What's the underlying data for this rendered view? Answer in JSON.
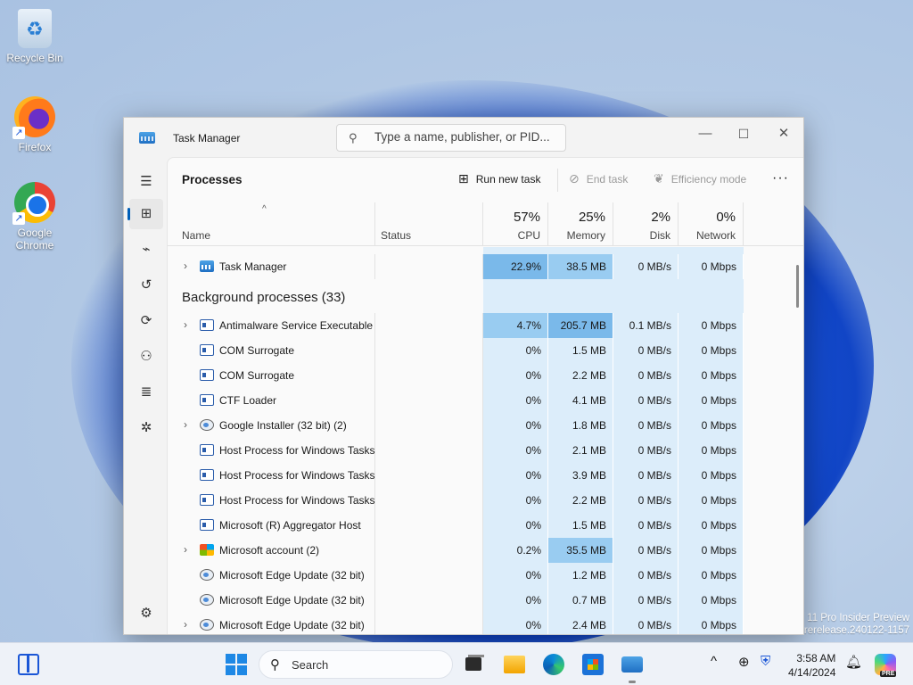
{
  "desktop": {
    "icons": [
      {
        "label": "Recycle Bin"
      },
      {
        "label": "Firefox"
      },
      {
        "label": "Google Chrome"
      }
    ],
    "watermark_line1": "11 Pro Insider Preview",
    "watermark_line2": "rerelease.240122-1157"
  },
  "window": {
    "title": "Task Manager",
    "search_placeholder": "Type a name, publisher, or PID...",
    "controls": {
      "minimize": "—",
      "maximize": "☐",
      "close": "✕"
    }
  },
  "toolbar": {
    "page_title": "Processes",
    "run_new_task": "Run new task",
    "end_task": "End task",
    "efficiency_mode": "Efficiency mode",
    "more": "···"
  },
  "columns": {
    "name": "Name",
    "status": "Status",
    "cpu": {
      "pct": "57%",
      "label": "CPU"
    },
    "memory": {
      "pct": "25%",
      "label": "Memory"
    },
    "disk": {
      "pct": "2%",
      "label": "Disk"
    },
    "network": {
      "pct": "0%",
      "label": "Network"
    }
  },
  "apps": [
    {
      "name": "Task Manager",
      "expand": true,
      "icon": "task-manager-icon",
      "cpu": "22.9%",
      "mem": "38.5 MB",
      "disk": "0 MB/s",
      "net": "0 Mbps"
    }
  ],
  "background_section": "Background processes (33)",
  "processes": [
    {
      "name": "Antimalware Service Executable",
      "expand": true,
      "icon": "service-icon",
      "cpu": "4.7%",
      "mem": "205.7 MB",
      "disk": "0.1 MB/s",
      "net": "0 Mbps"
    },
    {
      "name": "COM Surrogate",
      "expand": false,
      "icon": "service-icon",
      "cpu": "0%",
      "mem": "1.5 MB",
      "disk": "0 MB/s",
      "net": "0 Mbps"
    },
    {
      "name": "COM Surrogate",
      "expand": false,
      "icon": "service-icon",
      "cpu": "0%",
      "mem": "2.2 MB",
      "disk": "0 MB/s",
      "net": "0 Mbps"
    },
    {
      "name": "CTF Loader",
      "expand": false,
      "icon": "service-icon",
      "cpu": "0%",
      "mem": "4.1 MB",
      "disk": "0 MB/s",
      "net": "0 Mbps"
    },
    {
      "name": "Google Installer (32 bit) (2)",
      "expand": true,
      "icon": "installer-icon",
      "cpu": "0%",
      "mem": "1.8 MB",
      "disk": "0 MB/s",
      "net": "0 Mbps"
    },
    {
      "name": "Host Process for Windows Tasks",
      "expand": false,
      "icon": "service-icon",
      "cpu": "0%",
      "mem": "2.1 MB",
      "disk": "0 MB/s",
      "net": "0 Mbps"
    },
    {
      "name": "Host Process for Windows Tasks",
      "expand": false,
      "icon": "service-icon",
      "cpu": "0%",
      "mem": "3.9 MB",
      "disk": "0 MB/s",
      "net": "0 Mbps"
    },
    {
      "name": "Host Process for Windows Tasks",
      "expand": false,
      "icon": "service-icon",
      "cpu": "0%",
      "mem": "2.2 MB",
      "disk": "0 MB/s",
      "net": "0 Mbps"
    },
    {
      "name": "Microsoft (R) Aggregator Host",
      "expand": false,
      "icon": "service-icon",
      "cpu": "0%",
      "mem": "1.5 MB",
      "disk": "0 MB/s",
      "net": "0 Mbps"
    },
    {
      "name": "Microsoft account (2)",
      "expand": true,
      "icon": "microsoft-icon",
      "cpu": "0.2%",
      "mem": "35.5 MB",
      "disk": "0 MB/s",
      "net": "0 Mbps"
    },
    {
      "name": "Microsoft Edge Update (32 bit)",
      "expand": false,
      "icon": "installer-icon",
      "cpu": "0%",
      "mem": "1.2 MB",
      "disk": "0 MB/s",
      "net": "0 Mbps"
    },
    {
      "name": "Microsoft Edge Update (32 bit)",
      "expand": false,
      "icon": "installer-icon",
      "cpu": "0%",
      "mem": "0.7 MB",
      "disk": "0 MB/s",
      "net": "0 Mbps"
    },
    {
      "name": "Microsoft Edge Update (32 bit)",
      "expand": true,
      "icon": "installer-icon",
      "cpu": "0%",
      "mem": "2.4 MB",
      "disk": "0 MB/s",
      "net": "0 Mbps"
    }
  ],
  "taskbar": {
    "search_label": "Search",
    "time": "3:58 AM",
    "date": "4/14/2024",
    "pre_badge": "PRE"
  },
  "colors": {
    "accent": "#005fb8",
    "heat_low": "#dcedfa",
    "heat_mid": "#99ccf1"
  }
}
